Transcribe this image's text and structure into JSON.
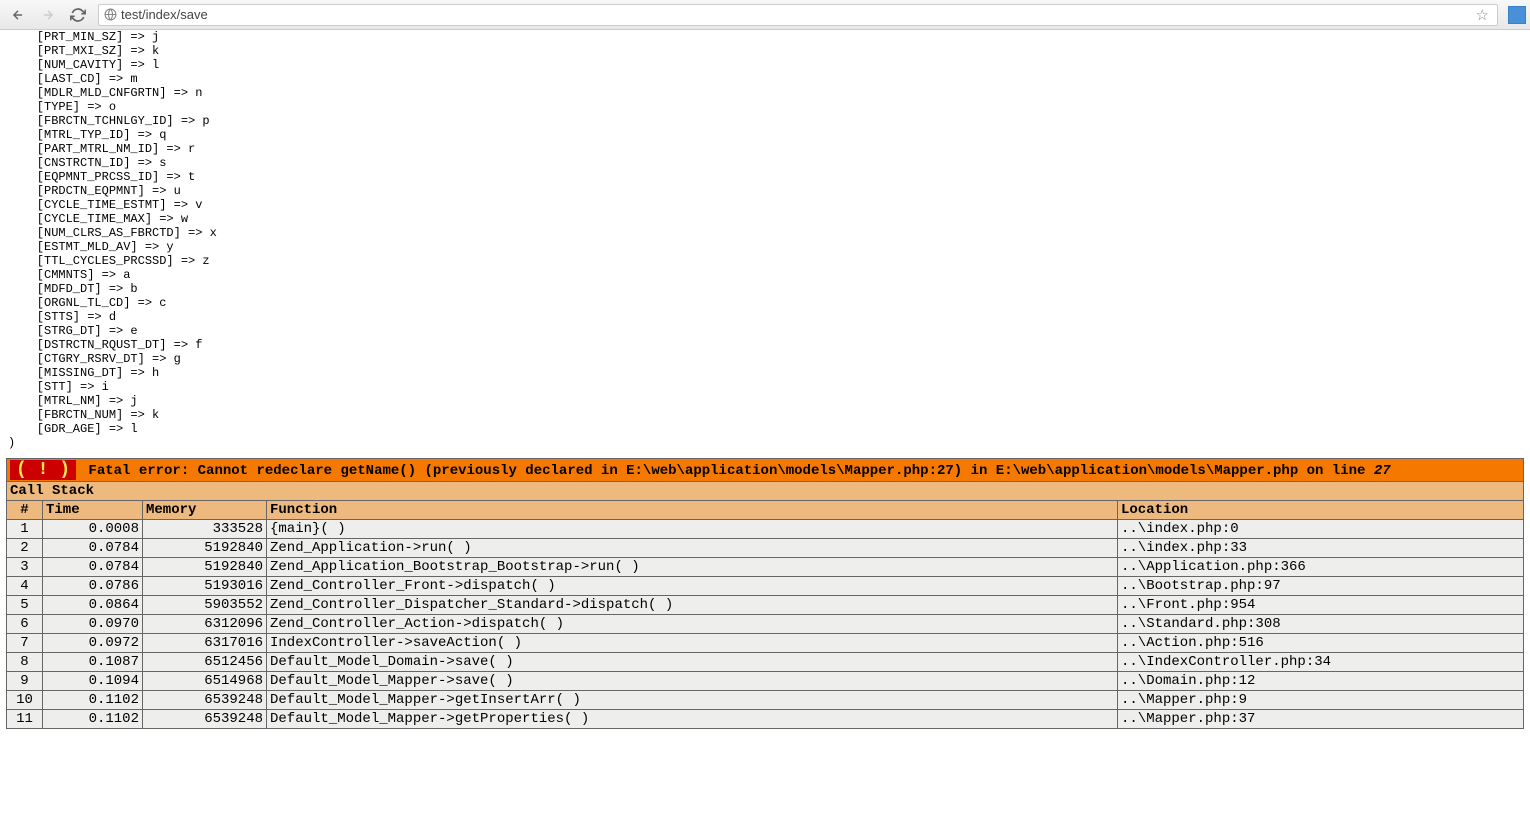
{
  "toolbar": {
    "url": "test/index/save"
  },
  "dump": {
    "lines": [
      "    [PRT_MIN_SZ] => j",
      "    [PRT_MXI_SZ] => k",
      "    [NUM_CAVITY] => l",
      "    [LAST_CD] => m",
      "    [MDLR_MLD_CNFGRTN] => n",
      "    [TYPE] => o",
      "    [FBRCTN_TCHNLGY_ID] => p",
      "    [MTRL_TYP_ID] => q",
      "    [PART_MTRL_NM_ID] => r",
      "    [CNSTRCTN_ID] => s",
      "    [EQPMNT_PRCSS_ID] => t",
      "    [PRDCTN_EQPMNT] => u",
      "    [CYCLE_TIME_ESTMT] => v",
      "    [CYCLE_TIME_MAX] => w",
      "    [NUM_CLRS_AS_FBRCTD] => x",
      "    [ESTMT_MLD_AV] => y",
      "    [TTL_CYCLES_PRCSSD] => z",
      "    [CMMNTS] => a",
      "    [MDFD_DT] => b",
      "    [ORGNL_TL_CD] => c",
      "    [STTS] => d",
      "    [STRG_DT] => e",
      "    [DSTRCTN_RQUST_DT] => f",
      "    [CTGRY_RSRV_DT] => g",
      "    [MISSING_DT] => h",
      "    [STT] => i",
      "    [MTRL_NM] => j",
      "    [FBRCTN_NUM] => k",
      "    [GDR_AGE] => l",
      ")"
    ]
  },
  "error": {
    "type": "Fatal error:",
    "message": "Cannot redeclare getName() (previously declared in E:\\web\\application\\models\\Mapper.php:27) in E:\\web\\application\\models\\Mapper.php on line",
    "line": "27",
    "callstack_title": "Call Stack",
    "columns": {
      "num": "#",
      "time": "Time",
      "mem": "Memory",
      "func": "Function",
      "loc": "Location"
    },
    "stack": [
      {
        "n": "1",
        "time": "0.0008",
        "mem": "333528",
        "func": "{main}( )",
        "loc": "..\\index.php:0"
      },
      {
        "n": "2",
        "time": "0.0784",
        "mem": "5192840",
        "func": "Zend_Application->run( )",
        "loc": "..\\index.php:33"
      },
      {
        "n": "3",
        "time": "0.0784",
        "mem": "5192840",
        "func": "Zend_Application_Bootstrap_Bootstrap->run( )",
        "loc": "..\\Application.php:366"
      },
      {
        "n": "4",
        "time": "0.0786",
        "mem": "5193016",
        "func": "Zend_Controller_Front->dispatch( )",
        "loc": "..\\Bootstrap.php:97"
      },
      {
        "n": "5",
        "time": "0.0864",
        "mem": "5903552",
        "func": "Zend_Controller_Dispatcher_Standard->dispatch( )",
        "loc": "..\\Front.php:954"
      },
      {
        "n": "6",
        "time": "0.0970",
        "mem": "6312096",
        "func": "Zend_Controller_Action->dispatch( )",
        "loc": "..\\Standard.php:308"
      },
      {
        "n": "7",
        "time": "0.0972",
        "mem": "6317016",
        "func": "IndexController->saveAction( )",
        "loc": "..\\Action.php:516"
      },
      {
        "n": "8",
        "time": "0.1087",
        "mem": "6512456",
        "func": "Default_Model_Domain->save( )",
        "loc": "..\\IndexController.php:34"
      },
      {
        "n": "9",
        "time": "0.1094",
        "mem": "6514968",
        "func": "Default_Model_Mapper->save( )",
        "loc": "..\\Domain.php:12"
      },
      {
        "n": "10",
        "time": "0.1102",
        "mem": "6539248",
        "func": "Default_Model_Mapper->getInsertArr( )",
        "loc": "..\\Mapper.php:9"
      },
      {
        "n": "11",
        "time": "0.1102",
        "mem": "6539248",
        "func": "Default_Model_Mapper->getProperties( )",
        "loc": "..\\Mapper.php:37"
      }
    ]
  }
}
